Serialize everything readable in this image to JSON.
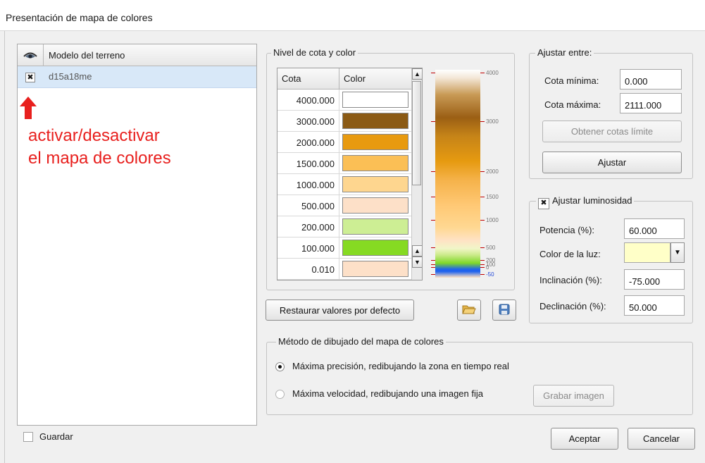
{
  "window": {
    "title": "Presentación de mapa de colores"
  },
  "layer_list": {
    "column_header": "Modelo del terreno",
    "rows": [
      {
        "name": "d15a18me",
        "active": true
      }
    ]
  },
  "annotation": {
    "line1": "activar/desactivar",
    "line2": "el mapa de colores",
    "color": "#e8201e"
  },
  "levels": {
    "group_label": "Nivel de cota y color",
    "col_cota": "Cota",
    "col_color": "Color",
    "rows": [
      {
        "cota": "4000.000",
        "color": "#ffffff"
      },
      {
        "cota": "3000.000",
        "color": "#8b5a14"
      },
      {
        "cota": "2000.000",
        "color": "#e89a0f"
      },
      {
        "cota": "1500.000",
        "color": "#fbbf55"
      },
      {
        "cota": "1000.000",
        "color": "#fed68f"
      },
      {
        "cota": "500.000",
        "color": "#fde0c8"
      },
      {
        "cota": "200.000",
        "color": "#cdee94"
      },
      {
        "cota": "100.000",
        "color": "#86da22"
      },
      {
        "cota": "0.010",
        "color": "#fde0c8"
      }
    ],
    "bar_labels": [
      "4000",
      "3000",
      "2000",
      "1500",
      "1000",
      "500",
      "200",
      "100",
      "0",
      "-50"
    ]
  },
  "adjust": {
    "group_label": "Ajustar entre:",
    "min_label": "Cota mínima:",
    "min_value": "0.000",
    "max_label": "Cota máxima:",
    "max_value": "2111.000",
    "get_limits_button": "Obtener cotas límite",
    "adjust_button": "Ajustar"
  },
  "luminosity": {
    "label": "Ajustar luminosidad",
    "enabled": true,
    "power_label": "Potencia (%):",
    "power_value": "60.000",
    "light_color_label": "Color de la luz:",
    "light_color": "#ffffc8",
    "inclination_label": "Inclinación (%):",
    "inclination_value": "-75.000",
    "declination_label": "Declinación (%):",
    "declination_value": "50.000"
  },
  "restore_button": "Restaurar valores por defecto",
  "method": {
    "group_label": "Método de dibujado del mapa de colores",
    "option_precision": "Máxima precisión, redibujando la zona en tiempo real",
    "option_speed": "Máxima velocidad, redibujando una imagen fija",
    "selected": "precision",
    "save_image_button": "Grabar imagen"
  },
  "footer": {
    "save_checkbox": "Guardar",
    "accept_button": "Aceptar",
    "cancel_button": "Cancelar"
  },
  "icons": {
    "eye": "eye-icon",
    "open": "folder-open-icon",
    "save": "floppy-disk-icon"
  }
}
